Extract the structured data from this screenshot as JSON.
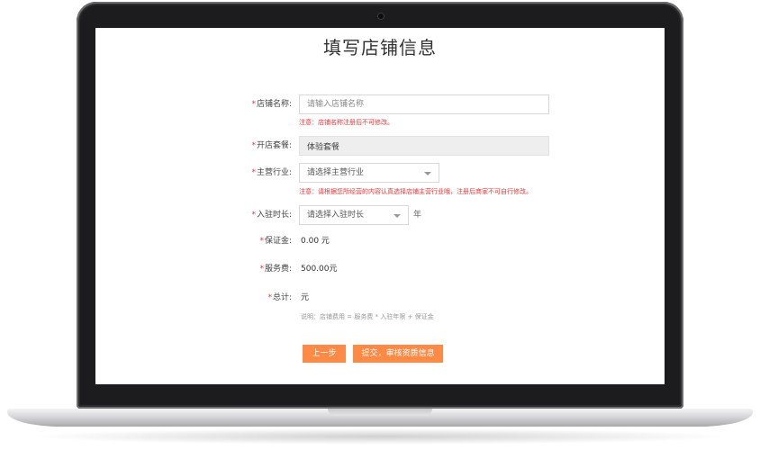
{
  "page": {
    "title": "填写店铺信息"
  },
  "form": {
    "required_mark": "*",
    "shop_name": {
      "label": "店铺名称:",
      "placeholder": "请输入店铺名称",
      "value": "",
      "hint": "注意：店铺名称注册后不可修改。"
    },
    "package": {
      "label": "开店套餐:",
      "value": "体验套餐"
    },
    "industry": {
      "label": "主营行业:",
      "selected": "请选择主营行业",
      "hint": "注意：请根据您所经营的内容认真选择店铺主营行业哦，注册后商家不可自行修改。"
    },
    "duration": {
      "label": "入驻时长:",
      "selected": "请选择入驻时长",
      "unit": "年"
    },
    "deposit": {
      "label": "保证金:",
      "value": "0.00 元"
    },
    "service_fee": {
      "label": "服务费:",
      "value": "500.00元"
    },
    "total": {
      "label": "总计:",
      "value": "元"
    },
    "note": "说明：店铺费用 = 服务费 * 入驻年限 + 保证金"
  },
  "buttons": {
    "prev": "上一步",
    "submit": "提交，审核资质信息"
  },
  "colors": {
    "accent": "#ff8a45",
    "warning": "#e4393c"
  }
}
